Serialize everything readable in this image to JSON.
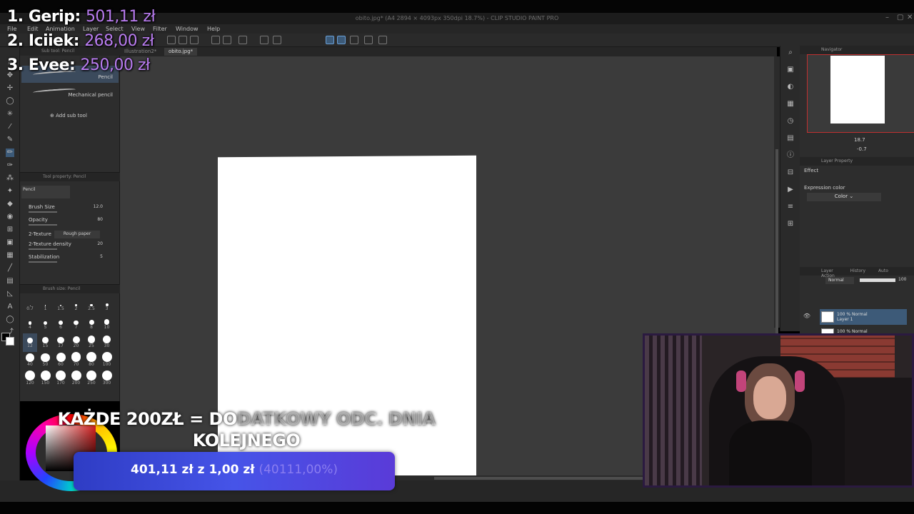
{
  "window": {
    "title": "obito.jpg* (A4 2894 × 4093px 350dpi 18.7%) - CLIP STUDIO PAINT PRO"
  },
  "menubar": [
    "File",
    "Edit",
    "Animation",
    "Layer",
    "Select",
    "View",
    "Filter",
    "Window",
    "Help"
  ],
  "tabs": [
    "Illustration2*",
    "obito.jpg*"
  ],
  "subtool": {
    "header": "Sub tool: Pencil",
    "items": [
      "Pencil",
      "Mechanical pencil"
    ],
    "add_label": "Add sub tool"
  },
  "tool_property": {
    "header": "Tool property: Pencil",
    "preset": "Pencil",
    "brush_size_label": "Brush Size",
    "brush_size_value": "12.0",
    "opacity_label": "Opacity",
    "opacity_value": "80",
    "texture_label": "2-Texture",
    "texture_value": "Rough paper",
    "texture_density_label": "2-Texture density",
    "texture_density_value": "20",
    "stabilization_label": "Stabilization",
    "stabilization_value": "5"
  },
  "brush_size": {
    "header": "Brush size: Pencil",
    "sizes": [
      "0.7",
      "1",
      "1.5",
      "2",
      "2.5",
      "3",
      "4",
      "5",
      "6",
      "7",
      "8",
      "10",
      "12",
      "15",
      "17",
      "20",
      "25",
      "30",
      "40",
      "50",
      "60",
      "70",
      "80",
      "100",
      "120",
      "150",
      "170",
      "200",
      "250",
      "300"
    ]
  },
  "navigator": {
    "header": "Navigator",
    "zoom": "18.7",
    "rotation": "-0.7"
  },
  "layer_property": {
    "header": "Layer Property",
    "effect_label": "Effect",
    "expression_label": "Expression color",
    "expression_value": "Color"
  },
  "layer_panel": {
    "tabs": [
      "Layer",
      "History",
      "Auto Action"
    ],
    "blend_mode": "Normal",
    "opacity": "100",
    "layers": [
      {
        "mode": "100 % Normal",
        "name": "Layer 1"
      },
      {
        "mode": "100 % Normal",
        "name": ""
      }
    ]
  },
  "donations": [
    {
      "rank": "1.",
      "name": "Gerip:",
      "amount": "501,11 zł"
    },
    {
      "rank": "2.",
      "name": "Iciiek:",
      "amount": "268,00 zł"
    },
    {
      "rank": "3.",
      "name": "Evee:",
      "amount": "250,00 zł"
    }
  ],
  "goal": {
    "title_line1_bright": "KAŻDE 200ZŁ = DO",
    "title_line1_faded": "DATKOWY ODC. DNIA",
    "title_line2": "KOLEJNEGO",
    "progress_text": "401,11 zł  z  1,00 zł",
    "progress_pct": "(40111,00%)"
  },
  "colors": {
    "accent": "#3c5a78",
    "donation_amount": "#b97cf0",
    "goal_bar": "#4654e8"
  }
}
